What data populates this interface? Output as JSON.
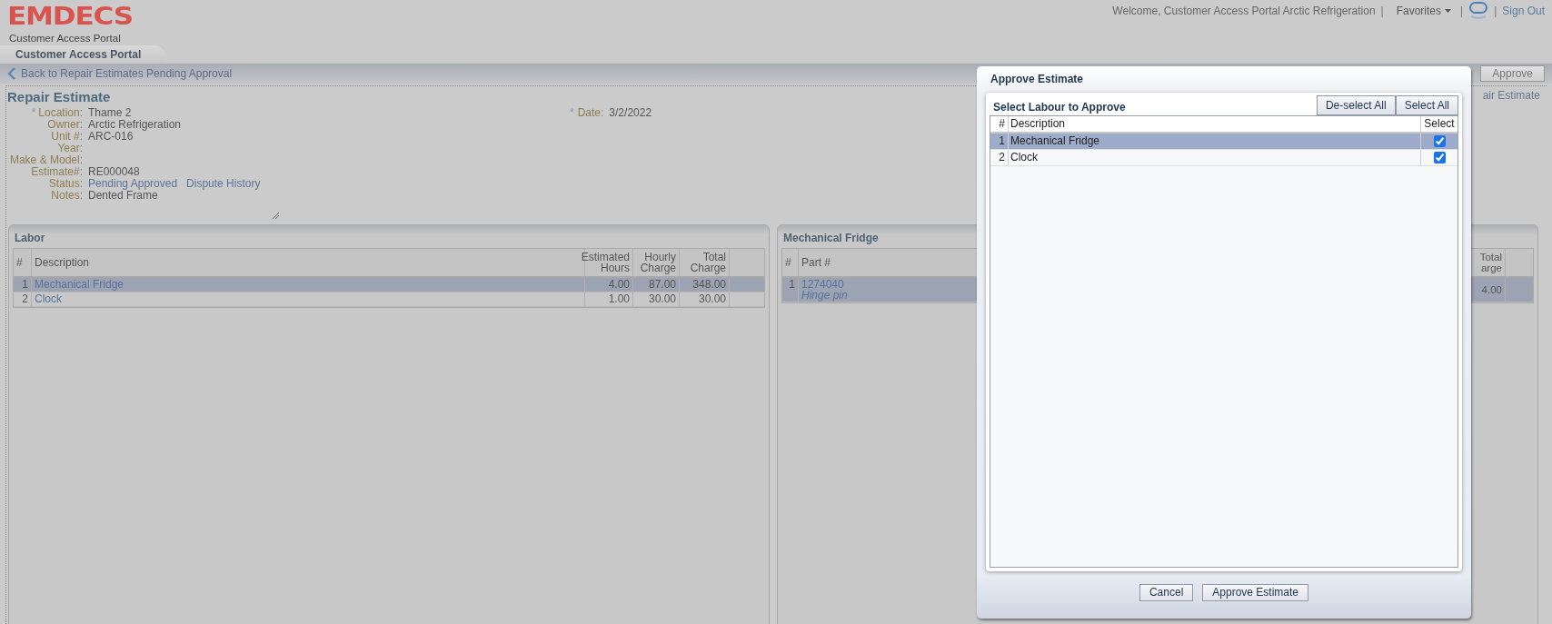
{
  "header": {
    "logo": "EMDECS",
    "subtitle": "Customer Access Portal",
    "welcome": "Welcome, Customer Access Portal Arctic Refrigeration",
    "separator": "|",
    "favorites": "Favorites",
    "sign_out": "Sign Out"
  },
  "tabs": [
    {
      "label": "Customer Access Portal",
      "selected": true
    }
  ],
  "toolbar": {
    "back_link": "Back to Repair Estimates Pending Approval",
    "approve_button": "Approve",
    "partial_link": "air Estimate"
  },
  "estimate": {
    "title": "Repair Estimate",
    "fields": [
      {
        "kind": "text",
        "required_mark": "*",
        "label": "Location:",
        "values": [
          "Thame 2"
        ]
      },
      {
        "kind": "text",
        "label": "Owner:",
        "values": [
          "Arctic Refrigeration"
        ]
      },
      {
        "kind": "text",
        "label": "Unit #:",
        "values": [
          "ARC-016"
        ]
      },
      {
        "kind": "text",
        "label": "Year:"
      },
      {
        "kind": "text",
        "label": "Make & Model:"
      },
      {
        "kind": "text",
        "label": "Estimate#:",
        "values": [
          "RE000048"
        ]
      },
      {
        "kind": "links",
        "label": "Status:",
        "values": [
          "Pending Approved",
          "Dispute History"
        ]
      },
      {
        "kind": "notes",
        "label": "Notes:",
        "values": [
          "Dented Frame"
        ]
      }
    ],
    "date": {
      "required_mark": "*",
      "label": "Date:",
      "value": "3/2/2022"
    }
  },
  "labor": {
    "title": "Labor",
    "columns": [
      "#",
      "Description",
      "Estimated Hours",
      "Hourly Charge",
      "Total Charge"
    ],
    "rows": [
      {
        "num": "1",
        "description": "Mechanical Fridge",
        "hours": "4.00",
        "rate": "87.00",
        "total": "348.00",
        "selected": true
      },
      {
        "num": "2",
        "description": "Clock",
        "hours": "1.00",
        "rate": "30.00",
        "total": "30.00",
        "selected": false
      }
    ]
  },
  "parts": {
    "title": "Mechanical Fridge",
    "columns": [
      "#",
      "Part #"
    ],
    "column_3": [
      "Total",
      "arge"
    ],
    "rows": [
      {
        "num": "1",
        "part": "1274040",
        "note": "Hinge pin",
        "column_3": "4.00",
        "selected": true
      }
    ]
  },
  "modal": {
    "title": "Approve Estimate",
    "section_title": "Select Labour to Approve",
    "buttons": [
      "De-select All",
      "Select All"
    ],
    "columns": [
      "#",
      "Description",
      "Select"
    ],
    "rows": [
      {
        "num": "1",
        "description": "Mechanical Fridge",
        "checked": true,
        "selected": true
      },
      {
        "num": "2",
        "description": "Clock",
        "checked": true,
        "selected": false
      }
    ],
    "footer_buttons": [
      "Cancel",
      "Approve Estimate"
    ]
  }
}
